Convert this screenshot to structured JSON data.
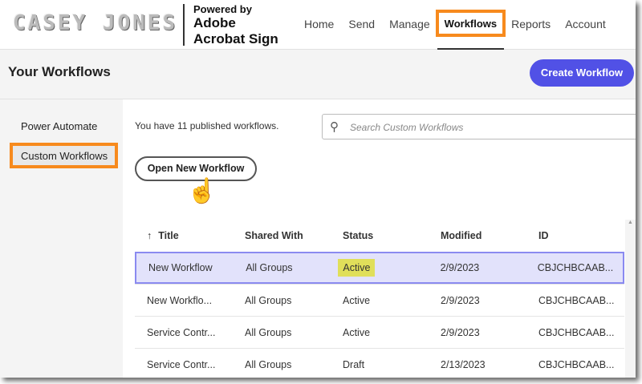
{
  "header": {
    "logo": "CASEY JONES",
    "powered_by": "Powered by",
    "brand_line1": "Adobe",
    "brand_line2": "Acrobat Sign",
    "nav": [
      {
        "label": "Home"
      },
      {
        "label": "Send"
      },
      {
        "label": "Manage"
      },
      {
        "label": "Workflows"
      },
      {
        "label": "Reports"
      },
      {
        "label": "Account"
      }
    ]
  },
  "page": {
    "title": "Your Workflows",
    "create_button": "Create Workflow"
  },
  "sidebar": {
    "items": [
      {
        "label": "Power Automate"
      },
      {
        "label": "Custom Workflows"
      }
    ]
  },
  "main": {
    "count_text": "You have 11 published workflows.",
    "search_placeholder": "Search Custom Workflows",
    "open_new_button": "Open New Workflow"
  },
  "table": {
    "sort_icon": "↑",
    "columns": [
      "Title",
      "Shared With",
      "Status",
      "Modified",
      "ID"
    ],
    "rows": [
      [
        "New Workflow",
        "All Groups",
        "Active",
        "2/9/2023",
        "CBJCHBCAAB..."
      ],
      [
        "New Workflo...",
        "All Groups",
        "Active",
        "2/9/2023",
        "CBJCHBCAAB..."
      ],
      [
        "Service Contr...",
        "All Groups",
        "Active",
        "2/9/2023",
        "CBJCHBCAAB..."
      ],
      [
        "Service Contr...",
        "All Groups",
        "Draft",
        "2/13/2023",
        "CBJCHBCAAB..."
      ]
    ]
  },
  "colors": {
    "accent": "#5151e6",
    "highlight": "#f78a1d",
    "status_highlight": "#e0df5a"
  }
}
